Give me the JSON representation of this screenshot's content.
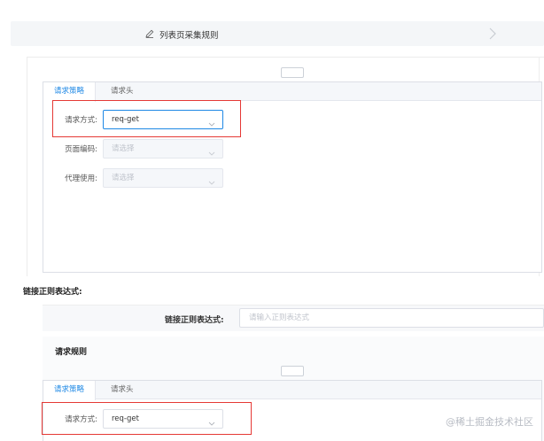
{
  "step": {
    "title": "列表页采集规则",
    "edit_icon": "pencil-icon",
    "next_icon": "chevron-right-icon"
  },
  "first_panel": {
    "tabs": [
      {
        "label": "请求策略",
        "active": true
      },
      {
        "label": "请求头",
        "active": false
      }
    ],
    "fields": {
      "method": {
        "label": "请求方式:",
        "value": "req-get"
      },
      "encoding": {
        "label": "页面编码:",
        "placeholder": "请选择"
      },
      "proxy": {
        "label": "代理使用:",
        "placeholder": "请选择"
      }
    }
  },
  "link_regex": {
    "section_label": "链接正则表达式:",
    "field_label": "链接正则表达式:",
    "placeholder": "请输入正则表达式"
  },
  "request_rule": {
    "title": "请求规则",
    "tabs": [
      {
        "label": "请求策略",
        "active": true
      },
      {
        "label": "请求头",
        "active": false
      }
    ],
    "fields": {
      "method": {
        "label": "请求方式:",
        "value": "req-get"
      }
    }
  },
  "watermark": "@稀土掘金技术社区",
  "colors": {
    "accent": "#1e88e5",
    "highlight": "#e53935",
    "border": "#dcdfe6"
  }
}
